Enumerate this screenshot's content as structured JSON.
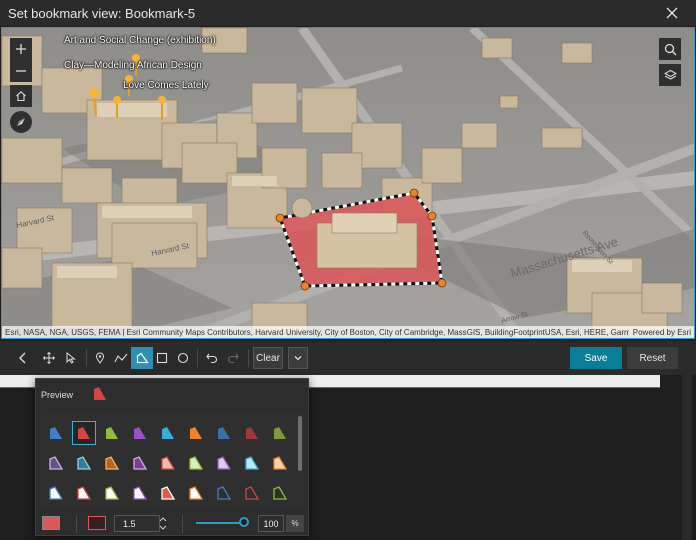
{
  "dialog": {
    "title": "Set bookmark view: Bookmark-5",
    "close_icon": "close-icon"
  },
  "map": {
    "poi_labels": [
      "Art and Social Change (exhibition)",
      "Clay—Modeling African Design",
      "Love Comes Lately"
    ],
    "street_labels": [
      "Harvard St",
      "Harvard St",
      "Remington St",
      "Massachusetts Ave",
      "Arrow St"
    ],
    "attribution": "Esri, NASA, NGA, USGS, FEMA | Esri Community Maps Contributors, Harvard University, City of Boston, City of Cambridge, MassGIS, BuildingFootprintUSA, Esri, HERE, Garmin, S...",
    "powered_by": "Powered by Esri",
    "colors": {
      "sketch_fill": "#d9585a",
      "vertex": "#e8842a",
      "frame_border": "#2a9bd1"
    }
  },
  "toolbar": {
    "back_icon": "arrow-left-icon",
    "tools": [
      "pan-icon",
      "select-icon",
      "point-icon",
      "polyline-icon",
      "polygon-icon",
      "rectangle-icon",
      "circle-icon",
      "undo-icon",
      "redo-icon"
    ],
    "active_tool": "polygon-icon",
    "clear_label": "Clear",
    "save_label": "Save",
    "reset_label": "Reset",
    "colors": {
      "save": "#0a7e99",
      "active": "#2e8fb3"
    }
  },
  "symbol_panel": {
    "preview_label": "Preview",
    "width_value": "1.5",
    "opacity_value": "100",
    "opacity_fraction": 1.0,
    "percent_label": "%",
    "fill_color": "#d9585a",
    "outline_color": "#3a1f1f",
    "swatch_rows": [
      [
        {
          "fill": "#3f7fc4",
          "stroke": "none"
        },
        {
          "fill": "#d34545",
          "stroke": "none"
        },
        {
          "fill": "#8fbf3a",
          "stroke": "none"
        },
        {
          "fill": "#9a52c2",
          "stroke": "none"
        },
        {
          "fill": "#3aaed8",
          "stroke": "none"
        },
        {
          "fill": "#e8842a",
          "stroke": "none"
        },
        {
          "fill": "#3c6fa8",
          "stroke": "none"
        },
        {
          "fill": "#9c3a3a",
          "stroke": "none"
        },
        {
          "fill": "#7f9a3c",
          "stroke": "none"
        }
      ],
      [
        {
          "fill": "#6a4f8c",
          "stroke": "#c6b3e0"
        },
        {
          "fill": "#2f7f9a",
          "stroke": "#8fd0e6"
        },
        {
          "fill": "#b8661f",
          "stroke": "#f0b070"
        },
        {
          "fill": "#7a3f8a",
          "stroke": "#d7a6e8"
        },
        {
          "fill": "#f3b9b5",
          "stroke": "#d34545"
        },
        {
          "fill": "#d9f0b8",
          "stroke": "#8fbf3a"
        },
        {
          "fill": "#e4c6f0",
          "stroke": "#9a52c2"
        },
        {
          "fill": "#bfe8f5",
          "stroke": "#3aaed8"
        },
        {
          "fill": "#f7d2ac",
          "stroke": "#e8842a"
        }
      ],
      [
        {
          "fill": "#ffffff",
          "stroke": "#3f7fc4"
        },
        {
          "fill": "#ffffff",
          "stroke": "#d34545"
        },
        {
          "fill": "#ffffff",
          "stroke": "#8fbf3a"
        },
        {
          "fill": "#ffffff",
          "stroke": "#9a52c2"
        },
        {
          "fill": "#e25a4a",
          "stroke": "#ffffff"
        },
        {
          "fill": "#ffffff",
          "stroke": "#e8842a"
        },
        {
          "fill": "none",
          "stroke": "#3f7fc4"
        },
        {
          "fill": "none",
          "stroke": "#d34545"
        },
        {
          "fill": "none",
          "stroke": "#8fbf3a"
        }
      ]
    ],
    "selected_swatch": "1"
  }
}
